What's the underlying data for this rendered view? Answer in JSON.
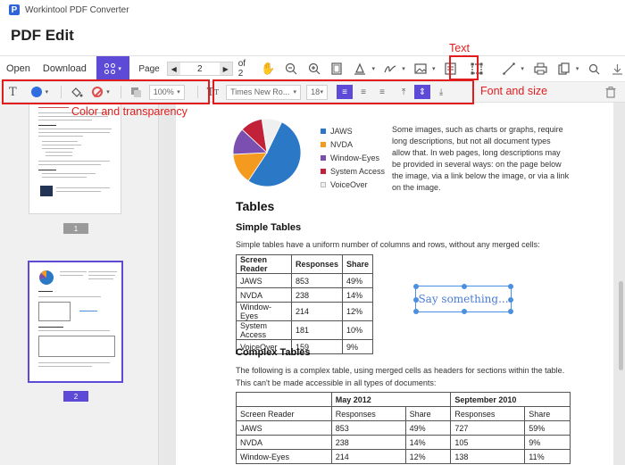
{
  "app": {
    "logo": "P",
    "title": "Workintool PDF Converter"
  },
  "page_heading": "PDF Edit",
  "toolbar": {
    "open_label": "Open",
    "download_label": "Download",
    "page_label": "Page",
    "current_page": "2",
    "of_label": "of 2",
    "icons": [
      "hand-icon",
      "zoom-out-icon",
      "zoom-in-icon",
      "page-icon",
      "highlight-icon",
      "signature-icon",
      "image-icon",
      "note-icon",
      "text-box-icon",
      "line-icon",
      "print-icon",
      "copy-icon",
      "search-icon",
      "download-icon"
    ]
  },
  "subbar": {
    "text_style_icon": "T",
    "color": "#2f6ee0",
    "opacity_value": "100%",
    "font_name": "Times New Ro...",
    "font_size": "18"
  },
  "annotations": {
    "text": "Text",
    "color_transparency": "Color and transparency",
    "font_size": "Font and size"
  },
  "thumbnails": {
    "page1": "1",
    "page2": "2"
  },
  "document": {
    "chart_data": {
      "type": "pie",
      "categories": [
        "JAWS",
        "NVDA",
        "Window-Eyes",
        "System Access",
        "VoiceOver"
      ],
      "values": [
        49,
        14,
        12,
        10,
        9
      ],
      "colors": [
        "#2a78c6",
        "#f49a1f",
        "#7a4fb0",
        "#c2213a",
        "#efefef"
      ]
    },
    "side_text": "Some images, such as charts or graphs, require long descriptions, but not all document types allow that. In web pages, long descriptions may be provided in several ways: on the page below the image, via a link below the image, or via a link on the image.",
    "tables_heading": "Tables",
    "simple_heading": "Simple Tables",
    "simple_para": "Simple tables have a uniform number of columns and rows, without any merged cells:",
    "simple_table": {
      "headers": [
        "Screen Reader",
        "Responses",
        "Share"
      ],
      "rows": [
        [
          "JAWS",
          "853",
          "49%"
        ],
        [
          "NVDA",
          "238",
          "14%"
        ],
        [
          "Window-Eyes",
          "214",
          "12%"
        ],
        [
          "System Access",
          "181",
          "10%"
        ],
        [
          "VoiceOver",
          "159",
          "9%"
        ]
      ]
    },
    "complex_heading": "Complex Tables",
    "complex_para": "The following is a complex table, using merged cells as headers for sections within the table. This can't be made accessible in all types of documents:",
    "complex_table": {
      "group1": "May 2012",
      "group2": "September 2010",
      "headers": [
        "Screen Reader",
        "Responses",
        "Share",
        "Responses",
        "Share"
      ],
      "rows": [
        [
          "JAWS",
          "853",
          "49%",
          "727",
          "59%"
        ],
        [
          "NVDA",
          "238",
          "14%",
          "105",
          "9%"
        ],
        [
          "Window-Eyes",
          "214",
          "12%",
          "138",
          "11%"
        ]
      ]
    },
    "textbox_text": "Say something..."
  }
}
